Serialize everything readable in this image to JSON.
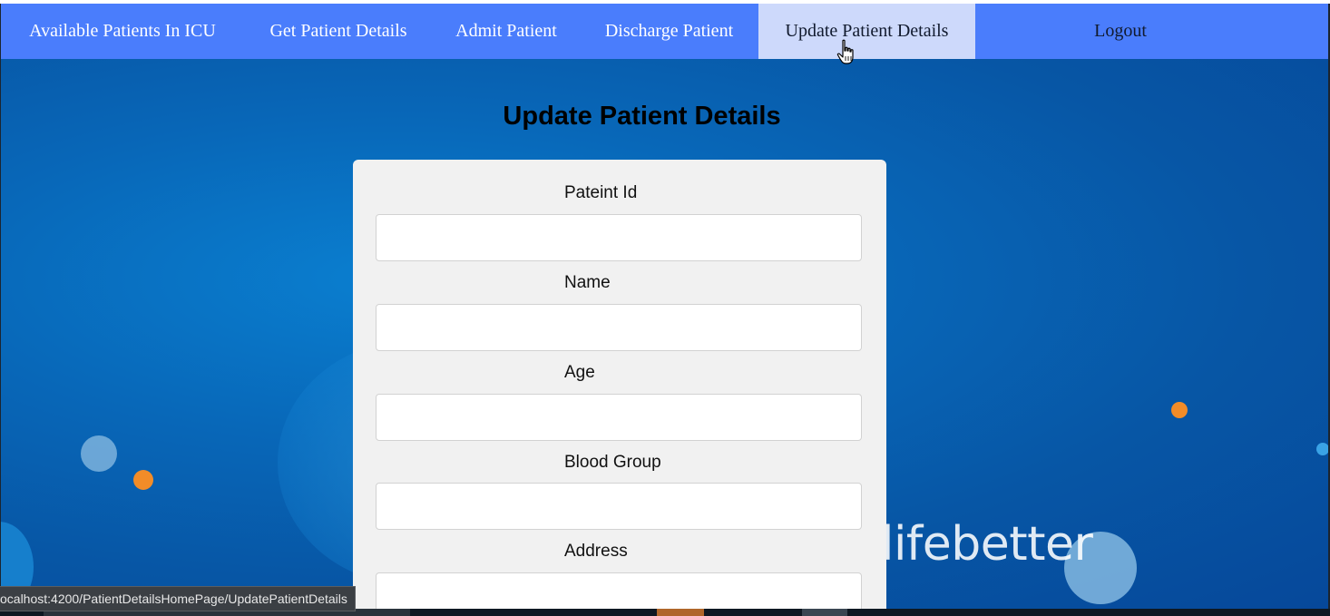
{
  "nav": {
    "items": [
      {
        "label": "Available Patients In ICU",
        "active": false
      },
      {
        "label": "Get Patient Details",
        "active": false
      },
      {
        "label": "Admit Patient",
        "active": false
      },
      {
        "label": "Discharge Patient",
        "active": false
      },
      {
        "label": "Update Patient Details",
        "active": true
      }
    ],
    "logout_label": "Logout"
  },
  "page": {
    "title": "Update Patient Details"
  },
  "form": {
    "fields": [
      {
        "label": "Pateint Id",
        "value": "",
        "placeholder": ""
      },
      {
        "label": "Name",
        "value": "",
        "placeholder": ""
      },
      {
        "label": "Age",
        "value": "",
        "placeholder": ""
      },
      {
        "label": "Blood Group",
        "value": "",
        "placeholder": ""
      },
      {
        "label": "Address",
        "value": "",
        "placeholder": ""
      }
    ]
  },
  "background": {
    "brand_text": "lifebetter"
  },
  "status_bar": {
    "url": "ocalhost:4200/PatientDetailsHomePage/UpdatePatientDetails"
  },
  "colors": {
    "navbar": "#4a7dfc",
    "nav_active": "#cdd9fb",
    "hero_blue": "#0867b8",
    "card": "#f1f1f1",
    "accent_orange": "#f28c28"
  },
  "icons": {
    "cursor": "hand-pointer-icon"
  }
}
